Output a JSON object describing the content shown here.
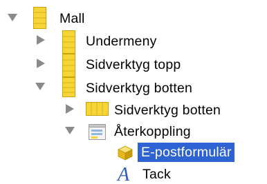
{
  "tree": {
    "items": [
      {
        "label": "Mall",
        "expanded": true,
        "icon": "template-page-icon"
      },
      {
        "label": "Undermeny",
        "expanded": false,
        "icon": "page-icon"
      },
      {
        "label": "Sidverktyg topp",
        "expanded": false,
        "icon": "page-icon"
      },
      {
        "label": "Sidverktyg botten",
        "expanded": true,
        "icon": "page-icon"
      },
      {
        "label": "Sidverktyg botten",
        "expanded": false,
        "icon": "column-layout-icon"
      },
      {
        "label": "Återkoppling",
        "expanded": true,
        "icon": "form-page-icon"
      },
      {
        "label": "E-postformulär",
        "selected": true,
        "icon": "cube-icon"
      },
      {
        "label": "Tack",
        "icon": "text-a-icon"
      }
    ]
  },
  "colors": {
    "selection": "#2e63d4",
    "page_icon_fill": "#f5d53a",
    "disclosure": "#8a8a8a"
  }
}
